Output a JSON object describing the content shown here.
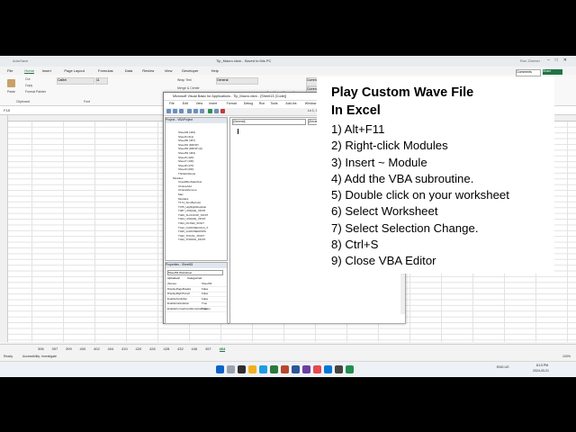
{
  "excel": {
    "title": "Tip_Macro.xlsm - Saved to this PC",
    "autosave_label": "AutoSave",
    "user": "Ron Zimmer",
    "menu": [
      "File",
      "Home",
      "Insert",
      "Page Layout",
      "Formulas",
      "Data",
      "Review",
      "View",
      "Developer",
      "Help"
    ],
    "active_menu": "Home",
    "ribbon": {
      "clipboard": "Clipboard",
      "font_name": "Calibri",
      "font_size": "11",
      "font_group": "Font",
      "alignment": "Alignment",
      "wrap_text": "Wrap Text",
      "merge": "Merge & Center",
      "number_format": "General",
      "number": "Number",
      "cond_format": "Conditional Formatting",
      "currency2": "Currency 2",
      "currency22": "Currency 2 2",
      "currency3": "Currency 3",
      "normal": "Normal",
      "styles": "Styles",
      "insert": "Insert",
      "delete": "Delete",
      "format": "Format",
      "cells": "Cells",
      "autosum": "AutoSum",
      "fill": "Fill",
      "clear": "Clear",
      "sort": "Sort & Filter",
      "find": "Find & Select",
      "editing": "Editing",
      "addins": "Add-ins",
      "analyze": "Analyze Data",
      "form": "Form",
      "comments": "Comments",
      "share": "Share",
      "paste": "Paste",
      "cut": "Cut",
      "copy": "Copy",
      "painter": "Format Painter",
      "new_group": "New Group"
    },
    "name_box": "F18",
    "sheet_tabs": [
      "396",
      "397",
      "399",
      "400",
      "402",
      "404",
      "410",
      "420",
      "426",
      "428",
      "432",
      "446",
      "457",
      "464"
    ],
    "active_sheet": "464",
    "status": "Ready",
    "accessibility": "Accessibility: Investigate",
    "zoom": "100%",
    "clock_time": "8:13 PM",
    "clock_date": "2024-03-21",
    "lang": "ENG US"
  },
  "vba": {
    "title": "Microsoft Visual Basic for Applications - Tip_Macro.xlsm - [Sheet13 (Code)]",
    "menu": [
      "File",
      "Edit",
      "View",
      "Insert",
      "Format",
      "Debug",
      "Run",
      "Tools",
      "Add-Ins",
      "Window",
      "Help"
    ],
    "position": "Ln 1, Col 1",
    "project_title": "Project - VBAProject",
    "tree": [
      {
        "kind": "sh",
        "text": "Sheet49 (446)"
      },
      {
        "kind": "sh",
        "text": "Sheet5 (411)"
      },
      {
        "kind": "sh",
        "text": "Sheet50 (457)"
      },
      {
        "kind": "sh",
        "text": "Sheet51 (DROP)"
      },
      {
        "kind": "sh",
        "text": "Sheet52 (DROP (2))"
      },
      {
        "kind": "sh",
        "text": "Sheet53 (464)"
      },
      {
        "kind": "sh",
        "text": "Sheet6 (120)"
      },
      {
        "kind": "sh",
        "text": "Sheet7 (130)"
      },
      {
        "kind": "sh",
        "text": "Sheet8 (170)"
      },
      {
        "kind": "sh",
        "text": "Sheet9 (200)"
      },
      {
        "kind": "sh",
        "text": "ThisWorkbook"
      },
      {
        "kind": "mod",
        "text": "Modules"
      },
      {
        "kind": "sh",
        "text": "CheckBoxStateTest"
      },
      {
        "kind": "sh",
        "text": "ChoiceAdd"
      },
      {
        "kind": "sh",
        "text": "ChoiceRemove"
      },
      {
        "kind": "sh",
        "text": "Mac"
      },
      {
        "kind": "sh",
        "text": "Module1"
      },
      {
        "kind": "sh",
        "text": "T174_SumByColor"
      },
      {
        "kind": "sh",
        "text": "T375_HighlightDuplicat"
      },
      {
        "kind": "sh",
        "text": "T387_UNIQUE_XFNIT"
      },
      {
        "kind": "sh",
        "text": "T400_XLOOKUP_XFNIT"
      },
      {
        "kind": "sh",
        "text": "T404_UNIQUE_XFNIT"
      },
      {
        "kind": "sh",
        "text": "T404_FILTER_XFNIT"
      },
      {
        "kind": "sh",
        "text": "T412_CHOOSECOLS_X"
      },
      {
        "kind": "sh",
        "text": "T420_CHOOSEROWS"
      },
      {
        "kind": "sh",
        "text": "T422_TOCOL_XFNIT"
      },
      {
        "kind": "sh",
        "text": "T422_TOROW_XFNIT"
      }
    ],
    "props_title": "Properties - Sheet53",
    "props_object": "Sheet53 Worksheet",
    "props_tabs": [
      "Alphabetic",
      "Categorized"
    ],
    "props_rows": [
      {
        "k": "(Name)",
        "v": "Sheet53"
      },
      {
        "k": "DisplayPageBreaks",
        "v": "False"
      },
      {
        "k": "DisplayRightToLeft",
        "v": "False"
      },
      {
        "k": "EnableAutoFilter",
        "v": "False"
      },
      {
        "k": "EnableCalculation",
        "v": "True"
      },
      {
        "k": "EnableFormatConditionsCalculation",
        "v": "True"
      }
    ],
    "object_combo": "(General)",
    "proc_combo": "(Declarations)"
  },
  "overlay": {
    "title_line1": "Play Custom Wave File",
    "title_line2": "In Excel",
    "steps": [
      "1) Alt+F11",
      "2) Right-click Modules",
      "3) Insert ~ Module",
      "4) Add the VBA subroutine.",
      "5) Double click on your worksheet",
      "6) Select Worksheet",
      "7) Select Selection Change.",
      "8) Ctrl+S",
      "9) Close VBA Editor"
    ]
  },
  "colors": {
    "excel_green": "#217346",
    "vba_blue": "#6a8fbf"
  }
}
